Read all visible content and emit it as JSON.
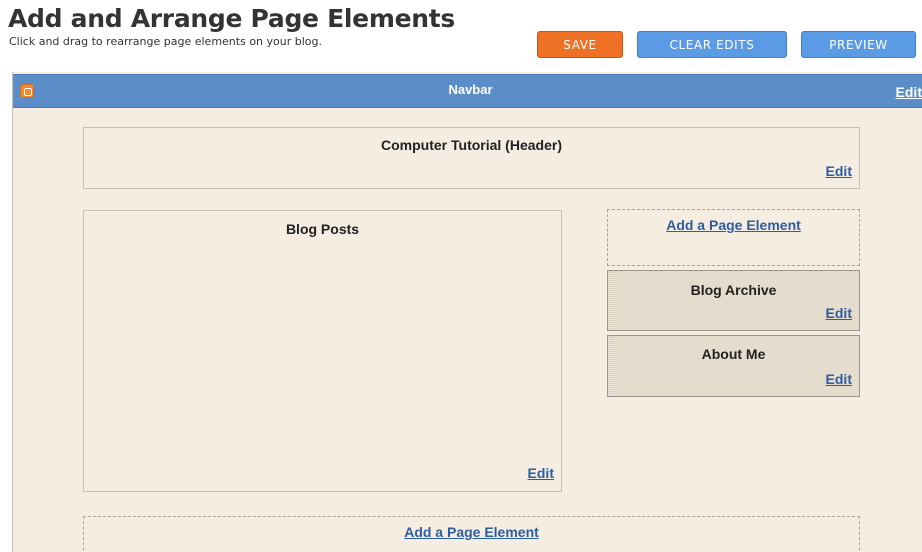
{
  "header": {
    "title": "Add and Arrange Page Elements",
    "subtitle": "Click and drag to rearrange page elements on your blog."
  },
  "toolbar": {
    "save_label": "SAVE",
    "clear_label": "CLEAR EDITS",
    "preview_label": "PREVIEW"
  },
  "navbar": {
    "label": "Navbar",
    "edit_label": "Edit"
  },
  "elements": {
    "header_element": {
      "title": "Computer Tutorial (Header)",
      "edit_label": "Edit"
    },
    "blog_posts": {
      "title": "Blog Posts",
      "edit_label": "Edit"
    },
    "sidebar_add": {
      "label": "Add a Page Element"
    },
    "blog_archive": {
      "title": "Blog Archive",
      "edit_label": "Edit"
    },
    "about_me": {
      "title": "About Me",
      "edit_label": "Edit"
    },
    "footer_add": {
      "label": "Add a Page Element"
    }
  },
  "colors": {
    "save": "#ee7126",
    "action": "#5b9be6",
    "navbar": "#5b8ec9",
    "canvas": "#f5ece2",
    "widget": "#e6dccd",
    "link": "#2d5ea0"
  }
}
